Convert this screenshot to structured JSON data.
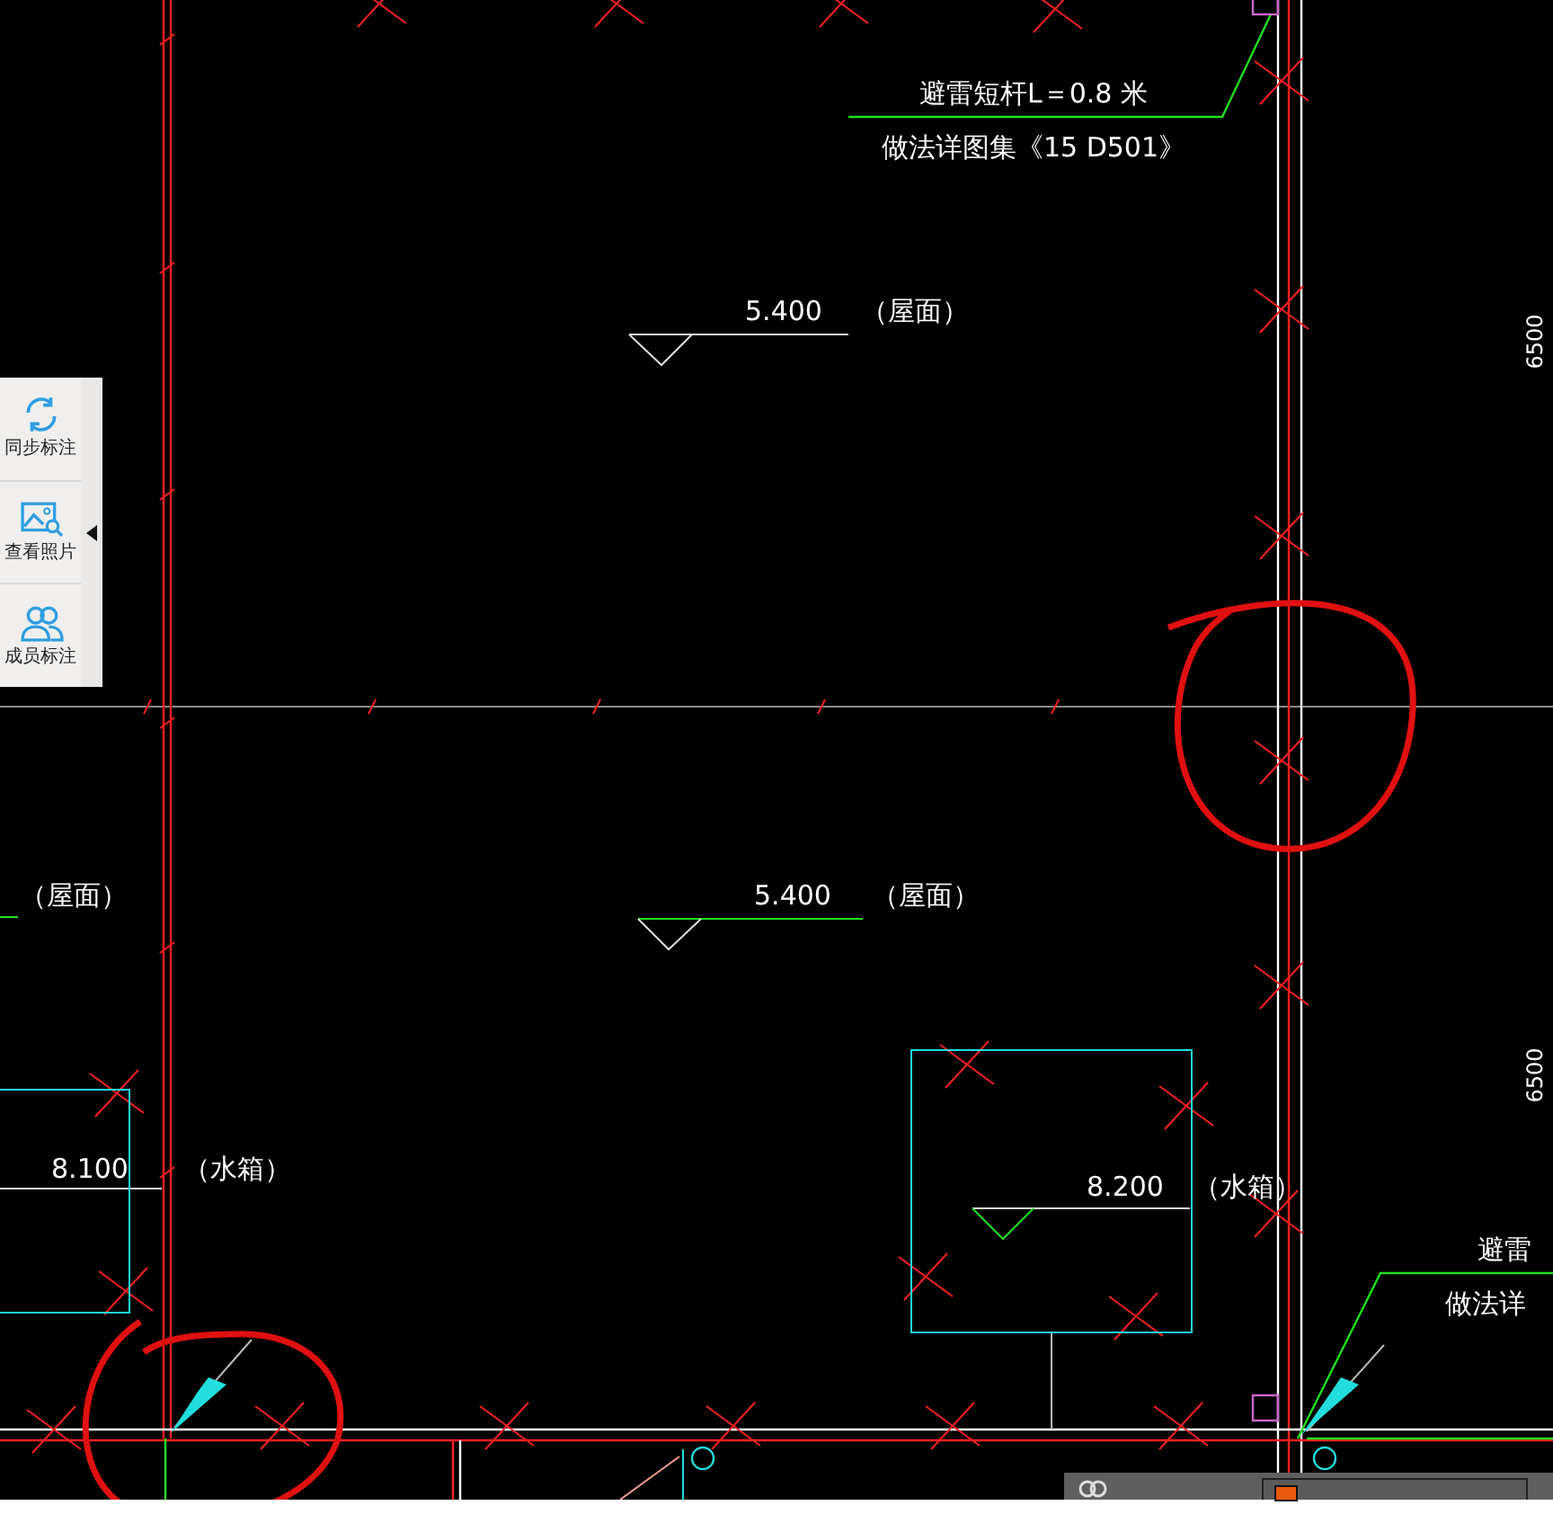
{
  "toolbar": {
    "items": [
      {
        "label": "同步标注",
        "kind": "sync"
      },
      {
        "label": "查看照片",
        "kind": "photo"
      },
      {
        "label": "成员标注",
        "kind": "members"
      }
    ]
  },
  "drawing": {
    "labels": [
      {
        "text": "避雷短杆L＝0.8 米",
        "kind": "note"
      },
      {
        "text": "做法详图集《15 D501》",
        "kind": "note"
      },
      {
        "text": "5.400",
        "kind": "elevation"
      },
      {
        "text": "（屋面）",
        "kind": "note"
      },
      {
        "text": "（屋面）",
        "kind": "note"
      },
      {
        "text": "5.400",
        "kind": "elevation"
      },
      {
        "text": "（屋面）",
        "kind": "note"
      },
      {
        "text": "8.100",
        "kind": "elevation"
      },
      {
        "text": "（水箱）",
        "kind": "note"
      },
      {
        "text": "8.200",
        "kind": "elevation"
      },
      {
        "text": "（水箱）",
        "kind": "note"
      },
      {
        "text": "避雷",
        "kind": "note"
      },
      {
        "text": "做法详",
        "kind": "note"
      },
      {
        "text": "6500",
        "kind": "dimension"
      },
      {
        "text": "6500",
        "kind": "dimension"
      }
    ]
  }
}
